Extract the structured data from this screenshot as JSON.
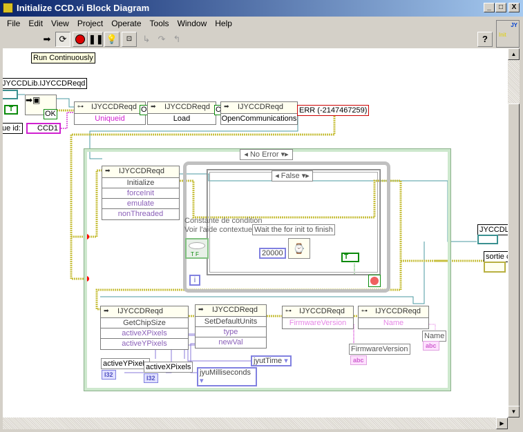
{
  "window": {
    "title": "Initialize CCD.vi Block Diagram",
    "minimize": "_",
    "maximize": "□",
    "close": "X"
  },
  "menu": [
    "File",
    "Edit",
    "View",
    "Project",
    "Operate",
    "Tools",
    "Window",
    "Help"
  ],
  "toolbar": {
    "run": "run-arrow",
    "run_continuously": "run-continuously",
    "abort": "abort",
    "pause": "pause",
    "highlight": "highlight-execution",
    "retain": "retain-wire-values",
    "step_into": "step-into",
    "step_over": "step-over",
    "step_out": "step-out",
    "help": "?"
  },
  "vi_icon": {
    "top": "JY",
    "bottom": "Init"
  },
  "tooltip": "Run Continuously",
  "diagram": {
    "class_label": "JYCCDLib.IJYCCDReqd",
    "unique_id_label": "ue id:",
    "unique_id_value": "CCD1",
    "bool_const": "T",
    "ok": "OK",
    "ok_short": "Ok",
    "nodes": [
      {
        "class": "IJYCCDReqd",
        "rows": [
          "Uniqueid"
        ]
      },
      {
        "class": "IJYCCDReqd",
        "rows": [
          "Load"
        ]
      },
      {
        "class": "IJYCCDReqd",
        "rows": [
          "OpenCommunications"
        ]
      }
    ],
    "error": "ERR (-2147467259)",
    "case_selector": "No Error",
    "init_node": {
      "class": "IJYCCDReqd",
      "rows": [
        "Initialize",
        "forceInit",
        "emulate",
        "nonThreaded"
      ]
    },
    "inner_case_selector": "False",
    "condition_label_1": "Constante de condition",
    "condition_label_2": "Voir l'aide contextuelle",
    "comment": "Wait the for init to finish",
    "wait_ms": "20000",
    "true_const": "T",
    "tf": "T F",
    "iteration": "i",
    "chip_node": {
      "class": "IJYCCDReqd",
      "rows": [
        "GetChipSize",
        "activeXPixels",
        "activeYPixels"
      ]
    },
    "units_node": {
      "class": "IJYCCDReqd",
      "rows": [
        "SetDefaultUnits",
        "type",
        "newVal"
      ]
    },
    "fw_node": {
      "class": "IJYCCDReqd",
      "rows": [
        "FirmwareVersion"
      ]
    },
    "name_node": {
      "class": "IJYCCDReqd",
      "rows": [
        "Name"
      ]
    },
    "active_y_label": "activeYPixels",
    "active_x_label": "activeXPixels",
    "i32": "I32",
    "jyut_time": "jyutTime",
    "jyu_ms": "jyuMilliseconds",
    "fw_label": "FirmwareVersion",
    "name_label": "Name",
    "abc": "abc",
    "out_class_label": "JYCCDLib",
    "out_error_label": "sortie c"
  },
  "colors": {
    "refnum_wire": "#4a9aa0",
    "error_wire": "#c8c040",
    "string_wire": "#e070e0",
    "numeric_wire": "#8a7ad8",
    "breakpoint": "#ff0000",
    "error_text": "#cc0000"
  }
}
